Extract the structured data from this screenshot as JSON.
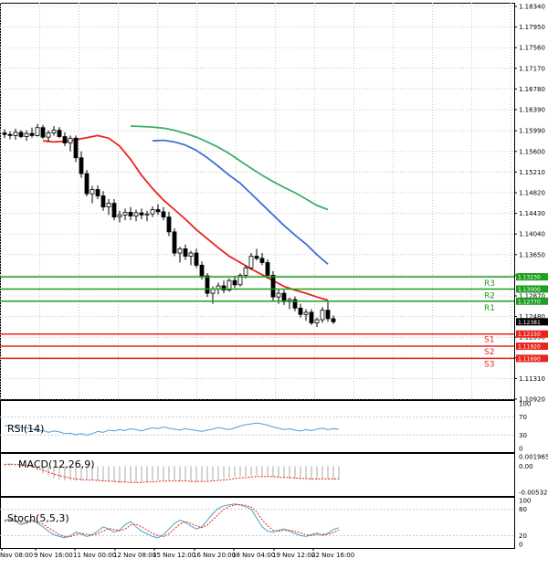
{
  "colors": {
    "background": "#ffffff",
    "grid": "#c8c8c8",
    "frame": "#000000",
    "candle_up": "#ffffff",
    "candle_down": "#000000",
    "ma_fast": "#e8241b",
    "ma_mid": "#3f6fd6",
    "ma_slow": "#3fae6a",
    "resistance": "#1f9e1f",
    "support": "#e8241b",
    "price_tag": "#000000",
    "rsi_line": "#4a9fe0",
    "macd_hist": "#a8a8a8",
    "macd_signal": "#e8241b",
    "stoch_main": "#4aa3cf",
    "stoch_signal": "#e8241b"
  },
  "chart_data": [
    {
      "type": "candlestick",
      "name": "price",
      "y_ticks": [
        "1.18340",
        "1.17950",
        "1.17560",
        "1.17170",
        "1.16780",
        "1.16390",
        "1.15990",
        "1.15600",
        "1.15210",
        "1.14820",
        "1.14430",
        "1.14040",
        "1.13650",
        "1.13260",
        "1.12870",
        "1.12480",
        "1.12090",
        "1.11700",
        "1.11310",
        "1.10920"
      ],
      "ylim": [
        1.1092,
        1.1834
      ],
      "current_price": 1.12381,
      "current_price_label": "1.12381",
      "levels": [
        {
          "name": "R3",
          "value": 1.1323,
          "label": "1.13230",
          "kind": "resistance"
        },
        {
          "name": "R2",
          "value": 1.13,
          "label": "1.13000",
          "kind": "resistance"
        },
        {
          "name": "R1",
          "value": 1.1277,
          "label": "1.12770",
          "kind": "resistance"
        },
        {
          "name": "S1",
          "value": 1.1215,
          "label": "1.12150",
          "kind": "support"
        },
        {
          "name": "S2",
          "value": 1.1192,
          "label": "1.11920",
          "kind": "support"
        },
        {
          "name": "S3",
          "value": 1.1169,
          "label": "1.11690",
          "kind": "support"
        }
      ],
      "candles": [
        [
          1.1595,
          1.1602,
          1.1585,
          1.1592
        ],
        [
          1.1592,
          1.1598,
          1.1583,
          1.159
        ],
        [
          1.159,
          1.1603,
          1.1582,
          1.1596
        ],
        [
          1.1596,
          1.16,
          1.1585,
          1.1588
        ],
        [
          1.1588,
          1.16,
          1.158,
          1.1594
        ],
        [
          1.1594,
          1.1605,
          1.1586,
          1.159
        ],
        [
          1.159,
          1.1612,
          1.1588,
          1.1605
        ],
        [
          1.1605,
          1.161,
          1.1584,
          1.1587
        ],
        [
          1.1587,
          1.16,
          1.1578,
          1.1595
        ],
        [
          1.1595,
          1.1608,
          1.159,
          1.16
        ],
        [
          1.16,
          1.1606,
          1.1585,
          1.1588
        ],
        [
          1.1588,
          1.1596,
          1.157,
          1.1576
        ],
        [
          1.1576,
          1.159,
          1.156,
          1.1585
        ],
        [
          1.1585,
          1.159,
          1.154,
          1.1548
        ],
        [
          1.1548,
          1.156,
          1.151,
          1.1518
        ],
        [
          1.1518,
          1.1525,
          1.1475,
          1.148
        ],
        [
          1.148,
          1.1495,
          1.1462,
          1.1488
        ],
        [
          1.1488,
          1.1496,
          1.147,
          1.1476
        ],
        [
          1.1476,
          1.1485,
          1.1448,
          1.1455
        ],
        [
          1.1455,
          1.147,
          1.144,
          1.1462
        ],
        [
          1.1462,
          1.147,
          1.143,
          1.1436
        ],
        [
          1.1436,
          1.1448,
          1.1426,
          1.144
        ],
        [
          1.144,
          1.1452,
          1.143,
          1.1445
        ],
        [
          1.1445,
          1.1455,
          1.143,
          1.1438
        ],
        [
          1.1438,
          1.145,
          1.1428,
          1.1444
        ],
        [
          1.1444,
          1.1452,
          1.1432,
          1.144
        ],
        [
          1.144,
          1.1448,
          1.1428,
          1.1442
        ],
        [
          1.1442,
          1.1456,
          1.1436,
          1.145
        ],
        [
          1.145,
          1.146,
          1.144,
          1.1446
        ],
        [
          1.1446,
          1.1455,
          1.143,
          1.1436
        ],
        [
          1.1436,
          1.1446,
          1.14,
          1.1408
        ],
        [
          1.1408,
          1.1415,
          1.1362,
          1.1368
        ],
        [
          1.1368,
          1.138,
          1.135,
          1.1376
        ],
        [
          1.1376,
          1.1384,
          1.1355,
          1.1362
        ],
        [
          1.1362,
          1.1372,
          1.1345,
          1.1368
        ],
        [
          1.1368,
          1.1376,
          1.134,
          1.1345
        ],
        [
          1.1345,
          1.1352,
          1.1318,
          1.1325
        ],
        [
          1.1325,
          1.133,
          1.1285,
          1.1292
        ],
        [
          1.1292,
          1.1305,
          1.1272,
          1.13
        ],
        [
          1.13,
          1.1312,
          1.129,
          1.1306
        ],
        [
          1.1306,
          1.1316,
          1.1292,
          1.1298
        ],
        [
          1.1298,
          1.132,
          1.1295,
          1.1316
        ],
        [
          1.1316,
          1.1325,
          1.1302,
          1.1308
        ],
        [
          1.1308,
          1.133,
          1.1305,
          1.1326
        ],
        [
          1.1326,
          1.1345,
          1.132,
          1.134
        ],
        [
          1.134,
          1.1368,
          1.1336,
          1.1362
        ],
        [
          1.1362,
          1.1376,
          1.1354,
          1.1358
        ],
        [
          1.1358,
          1.1368,
          1.1345,
          1.135
        ],
        [
          1.135,
          1.1356,
          1.132,
          1.1326
        ],
        [
          1.1326,
          1.1334,
          1.1278,
          1.1285
        ],
        [
          1.1285,
          1.13,
          1.1272,
          1.1292
        ],
        [
          1.1292,
          1.1298,
          1.127,
          1.1276
        ],
        [
          1.1276,
          1.1284,
          1.1262,
          1.128
        ],
        [
          1.128,
          1.1286,
          1.1258,
          1.1264
        ],
        [
          1.1264,
          1.1272,
          1.1246,
          1.1252
        ],
        [
          1.1252,
          1.1262,
          1.124,
          1.1256
        ],
        [
          1.1256,
          1.1262,
          1.1232,
          1.1236
        ],
        [
          1.1236,
          1.1246,
          1.1228,
          1.1242
        ],
        [
          1.1242,
          1.1266,
          1.1236,
          1.126
        ],
        [
          1.126,
          1.1276,
          1.1238,
          1.1244
        ],
        [
          1.1244,
          1.125,
          1.1234,
          1.1238
        ]
      ],
      "moving_averages": [
        {
          "role": "ma_fast",
          "values": [
            1.158,
            1.1578,
            1.1579,
            1.1582,
            1.1586,
            1.159,
            1.1585,
            1.157,
            1.1545,
            1.1515,
            1.149,
            1.1468,
            1.145,
            1.1432,
            1.1412,
            1.1395,
            1.1378,
            1.1362,
            1.135,
            1.1338,
            1.1327,
            1.1316,
            1.1305,
            1.1298,
            1.1292,
            1.1285,
            1.1279
          ]
        },
        {
          "role": "ma_mid",
          "values": [
            1.158,
            1.1581,
            1.1578,
            1.1572,
            1.1562,
            1.1548,
            1.1532,
            1.1515,
            1.15,
            1.148,
            1.146,
            1.144,
            1.142,
            1.1402,
            1.1385,
            1.1365,
            1.1347
          ]
        },
        {
          "role": "ma_slow",
          "values": [
            1.1608,
            1.1607,
            1.1606,
            1.1604,
            1.16,
            1.1594,
            1.1587,
            1.1578,
            1.1568,
            1.1556,
            1.1542,
            1.1528,
            1.1515,
            1.1503,
            1.1492,
            1.1482,
            1.147,
            1.1458,
            1.145
          ]
        }
      ]
    },
    {
      "type": "line",
      "name": "rsi",
      "title": "RSI(14)",
      "y_ticks": [
        "100",
        "70",
        "30",
        "0"
      ],
      "ylim": [
        0,
        100
      ],
      "values": [
        50,
        52,
        49,
        48,
        46,
        44,
        38,
        40,
        36,
        39,
        37,
        33,
        34,
        31,
        33,
        30,
        33,
        38,
        36,
        41,
        39,
        42,
        40,
        44,
        42,
        39,
        43,
        46,
        44,
        48,
        45,
        43,
        41,
        44,
        42,
        40,
        38,
        41,
        43,
        47,
        44,
        42,
        46,
        50,
        53,
        55,
        57,
        55,
        52,
        48,
        45,
        42,
        44,
        41,
        39,
        42,
        40,
        43,
        45,
        42,
        44,
        43
      ]
    },
    {
      "type": "bar",
      "name": "macd",
      "title": "MACD(12,26,9)",
      "y_ticks": [
        "0.001965",
        "0.00",
        "-0.005325"
      ],
      "ylim": [
        -0.005325,
        0.001965
      ],
      "values": [
        0.0005,
        0.0006,
        0.0004,
        0.0002,
        0.0001,
        -0.0003,
        -0.0009,
        -0.0015,
        -0.002,
        -0.0024,
        -0.0027,
        -0.0029,
        -0.003,
        -0.003,
        -0.0029,
        -0.0029,
        -0.0029,
        -0.003,
        -0.0031,
        -0.0032,
        -0.0033,
        -0.0034,
        -0.0034,
        -0.0034,
        -0.0033,
        -0.0032,
        -0.0031,
        -0.003,
        -0.0029,
        -0.0028,
        -0.0028,
        -0.0029,
        -0.003,
        -0.0031,
        -0.0032,
        -0.0032,
        -0.0031,
        -0.003,
        -0.0029,
        -0.0027,
        -0.0025,
        -0.0023,
        -0.0022,
        -0.0021,
        -0.002,
        -0.0019,
        -0.0019,
        -0.002,
        -0.0021,
        -0.0022,
        -0.0023,
        -0.0024,
        -0.0025,
        -0.0026,
        -0.0027,
        -0.0027,
        -0.0028,
        -0.0027,
        -0.0026,
        -0.0026,
        -0.0027,
        -0.0027
      ],
      "signal": [
        0.0004,
        0.0004,
        0.0004,
        0.0003,
        0.0002,
        0.0,
        -0.0004,
        -0.0008,
        -0.0012,
        -0.0016,
        -0.0019,
        -0.0022,
        -0.0024,
        -0.0026,
        -0.0027,
        -0.0028,
        -0.0028,
        -0.0029,
        -0.003,
        -0.003,
        -0.0031,
        -0.0032,
        -0.0032,
        -0.0033,
        -0.0033,
        -0.0033,
        -0.0032,
        -0.0032,
        -0.0031,
        -0.003,
        -0.003,
        -0.003,
        -0.003,
        -0.003,
        -0.0031,
        -0.0031,
        -0.0031,
        -0.0031,
        -0.003,
        -0.0029,
        -0.0028,
        -0.0027,
        -0.0025,
        -0.0024,
        -0.0023,
        -0.0022,
        -0.0021,
        -0.0021,
        -0.0021,
        -0.0021,
        -0.0022,
        -0.0023,
        -0.0023,
        -0.0024,
        -0.0025,
        -0.0025,
        -0.0026,
        -0.0026,
        -0.0026,
        -0.0026,
        -0.0026,
        -0.0026
      ]
    },
    {
      "type": "line",
      "name": "stochastic",
      "title": "Stoch(5,5,3)",
      "y_ticks": [
        "100",
        "80",
        "20",
        "0"
      ],
      "ylim": [
        0,
        100
      ],
      "main": [
        55,
        58,
        52,
        45,
        50,
        56,
        48,
        40,
        30,
        22,
        18,
        15,
        20,
        28,
        24,
        18,
        22,
        30,
        40,
        35,
        28,
        33,
        45,
        52,
        40,
        30,
        24,
        18,
        15,
        22,
        35,
        48,
        55,
        50,
        42,
        35,
        40,
        55,
        70,
        82,
        88,
        90,
        92,
        90,
        86,
        80,
        60,
        40,
        30,
        28,
        32,
        35,
        30,
        25,
        20,
        18,
        22,
        26,
        20,
        25,
        34,
        38
      ],
      "signal": [
        52,
        55,
        54,
        50,
        48,
        52,
        52,
        46,
        38,
        30,
        22,
        18,
        17,
        22,
        25,
        23,
        21,
        24,
        30,
        36,
        34,
        31,
        35,
        44,
        46,
        40,
        32,
        25,
        20,
        18,
        24,
        35,
        46,
        52,
        48,
        42,
        38,
        44,
        56,
        68,
        80,
        86,
        90,
        90,
        89,
        85,
        74,
        56,
        42,
        32,
        30,
        32,
        32,
        30,
        26,
        22,
        20,
        22,
        23,
        23,
        27,
        33
      ]
    }
  ],
  "time_labels": [
    "Nov 08:00",
    "9 Nov 16:00",
    "11 Nov 00:00",
    "12 Nov 08:00",
    "15 Nov 12:00",
    "16 Nov 20:00",
    "18 Nov 04:00",
    "19 Nov 12:00",
    "22 Nov 16:00"
  ]
}
